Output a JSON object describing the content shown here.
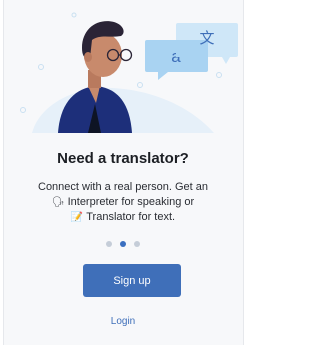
{
  "screen": {
    "title": "Need a translator?",
    "body_line1": "Connect with a real person. Get an",
    "interpreter_icon": "speaking-head-icon",
    "body_line2": " Interpreter for speaking or",
    "translator_icon": "memo-icon",
    "body_line3": " Translator for text."
  },
  "pagination": {
    "total": 3,
    "active_index": 1
  },
  "actions": {
    "signup_label": "Sign up",
    "login_label": "Login"
  },
  "illustration": {
    "bubble_left_glyph": "a",
    "bubble_right_glyph": "文"
  },
  "colors": {
    "primary": "#3f6fb9",
    "title": "#1c1f24",
    "shirt": "#1d2f7a",
    "bubble": "#a9d3f2",
    "bubble_dark": "#6ab1e8",
    "dot_inactive": "#c5cdd8"
  }
}
